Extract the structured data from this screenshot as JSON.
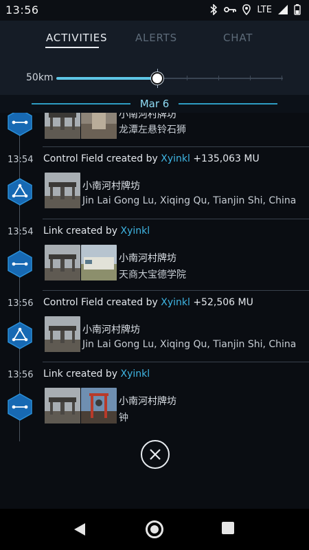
{
  "status_bar": {
    "time": "13:56",
    "network": "LTE"
  },
  "tabs": {
    "activities": "ACTIVITIES",
    "alerts": "ALERTS",
    "chat": "CHAT"
  },
  "range": {
    "label": "50km"
  },
  "date_header": "Mar 6",
  "feed": {
    "partial_top": {
      "portal_name": "小南河村牌坊",
      "portal_addr": "龙潭左悬铃石狮"
    },
    "entries": [
      {
        "time": "13:54",
        "action": "Control Field created by",
        "agent": "Xyinkl",
        "mu": "+135,063 MU",
        "portal_name": "小南河村牌坊",
        "portal_addr": "Jin Lai Gong Lu, Xiqing Qu, Tianjin Shi, China"
      },
      {
        "time": "13:54",
        "action": "Link created by",
        "agent": "Xyinkl",
        "portal_name": "小南河村牌坊",
        "portal_addr": "天商大宝德学院"
      },
      {
        "time": "13:56",
        "action": "Control Field created by",
        "agent": "Xyinkl",
        "mu": "+52,506 MU",
        "portal_name": "小南河村牌坊",
        "portal_addr": "Jin Lai Gong Lu, Xiqing Qu, Tianjin Shi, China"
      },
      {
        "time": "13:56",
        "action": "Link created by",
        "agent": "Xyinkl",
        "portal_name": "小南河村牌坊",
        "portal_addr": "钟"
      }
    ]
  },
  "icons": {
    "field": "control-field-icon",
    "link": "link-icon",
    "close": "close-icon"
  },
  "colors": {
    "accent": "#3fb6e4",
    "hex_fill": "#1769b3",
    "date": "#8fdcf5"
  }
}
